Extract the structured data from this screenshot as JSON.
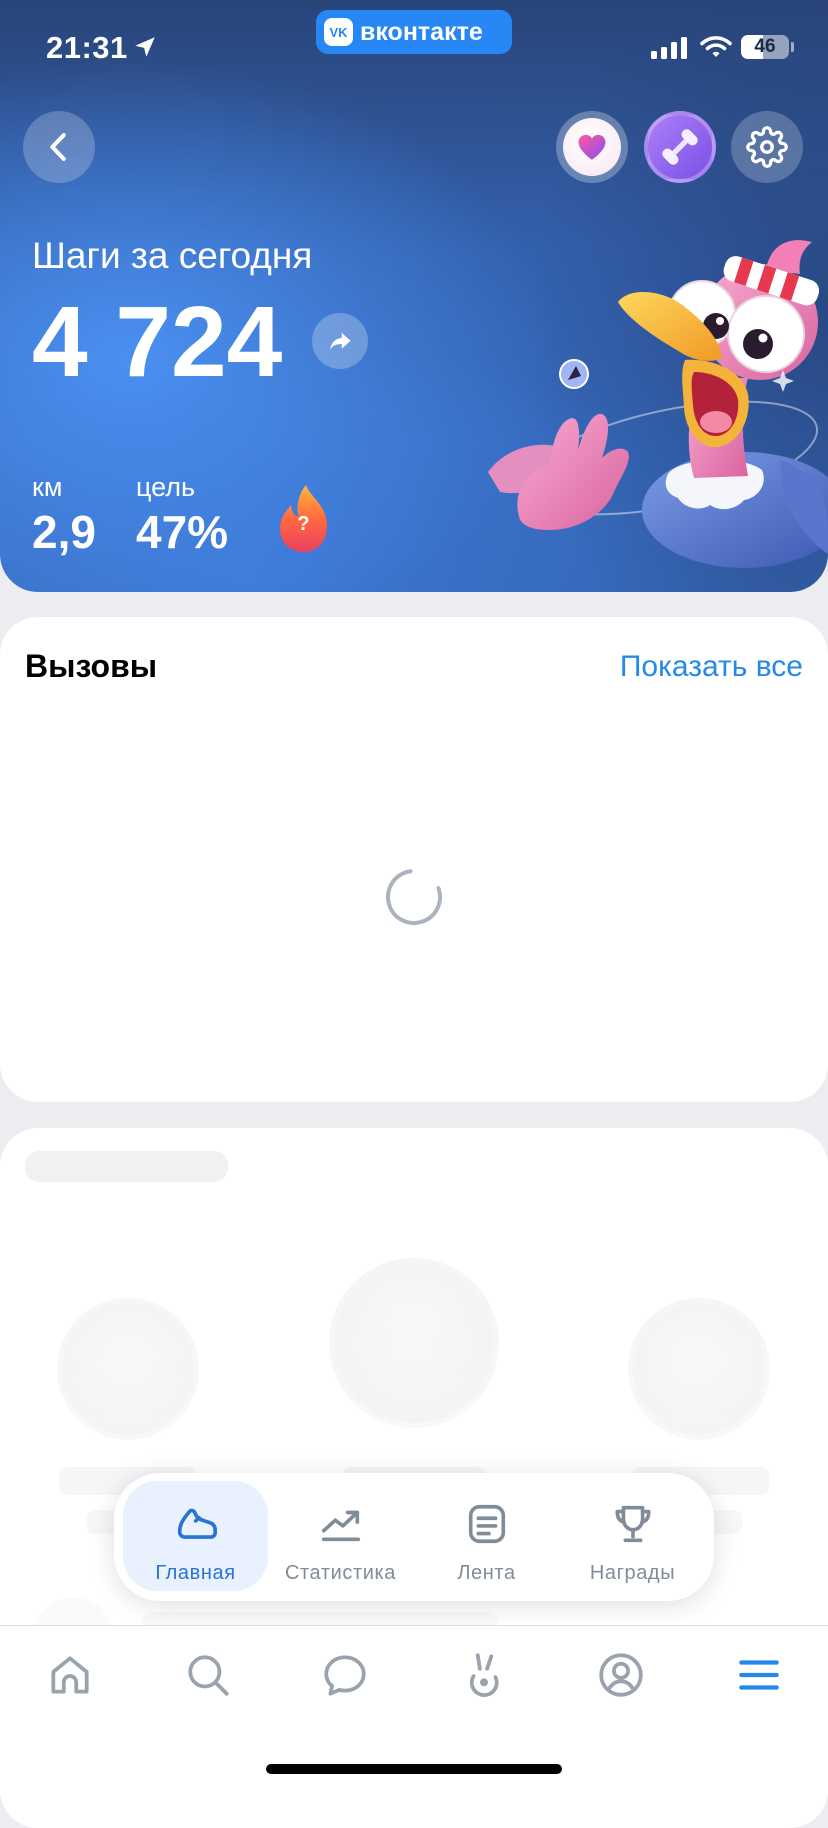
{
  "status_bar": {
    "time": "21:31",
    "app_badge": "вконтакте",
    "battery_level": "46",
    "icons": [
      "location-arrow-icon",
      "signal-icon",
      "wifi-icon",
      "battery-icon"
    ]
  },
  "header": {
    "title": "Шаги за сегодня",
    "steps": "4 724",
    "distance_label": "км",
    "distance_value": "2,9",
    "goal_label": "цель",
    "goal_value": "47%",
    "streak_badge": "?",
    "icons": {
      "back": "back-chevron-icon",
      "health": "heart-icon",
      "workout": "dumbbell-icon",
      "settings": "gear-icon",
      "share": "share-arrow-icon",
      "streak": "flame-icon",
      "mascot": "mascot-illustration"
    }
  },
  "challenges": {
    "title": "Вызовы",
    "show_all": "Показать все",
    "icon": "loading-spinner-icon"
  },
  "tab_bar": {
    "items": [
      {
        "label": "Главная",
        "icon": "sneaker-icon",
        "active": true
      },
      {
        "label": "Статистика",
        "icon": "trend-chart-icon",
        "active": false
      },
      {
        "label": "Лента",
        "icon": "feed-icon",
        "active": false
      },
      {
        "label": "Награды",
        "icon": "trophy-icon",
        "active": false
      }
    ]
  },
  "bottom_nav": {
    "items": [
      {
        "icon": "home-icon",
        "active": false
      },
      {
        "icon": "search-icon",
        "active": false
      },
      {
        "icon": "messages-icon",
        "active": false
      },
      {
        "icon": "clips-icon",
        "active": false
      },
      {
        "icon": "profile-icon",
        "active": false
      },
      {
        "icon": "menu-icon",
        "active": true
      }
    ]
  },
  "colors": {
    "accent": "#2688eb",
    "header_blue": "#3f7fe0",
    "header_dark": "#29457a",
    "page_background": "#ebedf0",
    "card": "#ffffff",
    "inactive_icon": "#99a2ad",
    "workout_purple": "#8a5cf0",
    "streak_orange": "#ff6a3d"
  }
}
